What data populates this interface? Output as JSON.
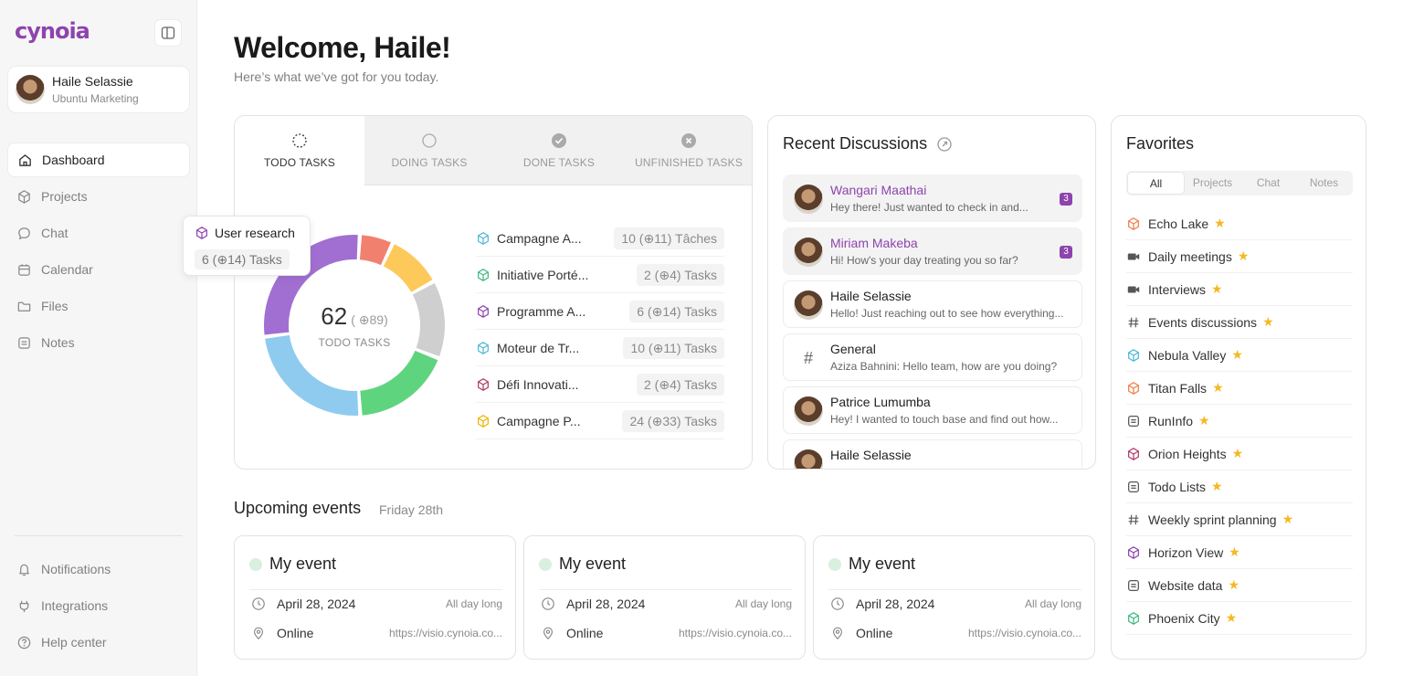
{
  "brand": {
    "logo": "cynoia"
  },
  "user": {
    "name": "Haile Selassie",
    "org": "Ubuntu Marketing"
  },
  "nav": {
    "main": [
      {
        "label": "Dashboard",
        "icon": "home-icon",
        "active": true
      },
      {
        "label": "Projects",
        "icon": "cube-icon"
      },
      {
        "label": "Chat",
        "icon": "chat-icon"
      },
      {
        "label": "Calendar",
        "icon": "calendar-icon"
      },
      {
        "label": "Files",
        "icon": "folder-icon"
      },
      {
        "label": "Notes",
        "icon": "note-icon"
      }
    ],
    "bottom": [
      {
        "label": "Notifications",
        "icon": "bell-icon"
      },
      {
        "label": "Integrations",
        "icon": "plug-icon"
      },
      {
        "label": "Help center",
        "icon": "help-icon"
      }
    ]
  },
  "header": {
    "title": "Welcome, Haile!",
    "subtitle": "Here’s what we’ve got for you today."
  },
  "tasks": {
    "tabs": [
      {
        "label": "TODO TASKS",
        "icon": "dashed-circle-icon",
        "active": true
      },
      {
        "label": "DOING TASKS",
        "icon": "half-circle-icon"
      },
      {
        "label": "DONE TASKS",
        "icon": "check-circle-icon"
      },
      {
        "label": "UNFINISHED TASKS",
        "icon": "x-circle-icon"
      }
    ],
    "total": "62",
    "total_all": "89",
    "center_label": "TODO TASKS",
    "tooltip": {
      "name": "User research",
      "count": "6",
      "total": "14",
      "unit": "Tasks"
    },
    "projects": [
      {
        "name": "Campagne A...",
        "count": "10",
        "total": "11",
        "unit": "Tâches",
        "color": "#4fb8d6"
      },
      {
        "name": "Initiative Porté...",
        "count": "2",
        "total": "4",
        "unit": "Tasks",
        "color": "#3fb87f"
      },
      {
        "name": "Programme A...",
        "count": "6",
        "total": "14",
        "unit": "Tasks",
        "color": "#8e44ad"
      },
      {
        "name": "Moteur de Tr...",
        "count": "10",
        "total": "11",
        "unit": "Tasks",
        "color": "#4fb8d6"
      },
      {
        "name": "Défi Innovati...",
        "count": "2",
        "total": "4",
        "unit": "Tasks",
        "color": "#b03a6a"
      },
      {
        "name": "Campagne P...",
        "count": "24",
        "total": "33",
        "unit": "Tasks",
        "color": "#f0b400"
      }
    ],
    "chart_segments": [
      {
        "color": "#f2806e",
        "value": 6
      },
      {
        "color": "#fdc95a",
        "value": 10
      },
      {
        "color": "#cfcfcf",
        "value": 14
      },
      {
        "color": "#5fd47e",
        "value": 18
      },
      {
        "color": "#8fcbef",
        "value": 24
      },
      {
        "color": "#a16fd1",
        "value": 28
      }
    ]
  },
  "discussions": {
    "title": "Recent Discussions",
    "items": [
      {
        "name": "Wangari Maathai",
        "message": "Hey there! Just wanted to check in and...",
        "unread": "3",
        "type": "user"
      },
      {
        "name": "Miriam Makeba",
        "message": "Hi! How's your day treating you so far?",
        "unread": "3",
        "type": "user"
      },
      {
        "name": "Haile Selassie",
        "message": "Hello! Just reaching out to see how everything...",
        "unread": "",
        "type": "user"
      },
      {
        "name": "General",
        "message": "Aziza Bahnini: Hello team, how are you doing?",
        "unread": "",
        "type": "channel"
      },
      {
        "name": "Patrice Lumumba",
        "message": "Hey! I wanted to touch base and find out how...",
        "unread": "",
        "type": "user"
      },
      {
        "name": "Haile Selassie",
        "message": "",
        "unread": "",
        "type": "user"
      }
    ]
  },
  "favorites": {
    "title": "Favorites",
    "tabs": [
      "All",
      "Projects",
      "Chat",
      "Notes"
    ],
    "items": [
      {
        "label": "Echo Lake",
        "icon": "cube-icon",
        "color": "#f07e4a"
      },
      {
        "label": "Daily meetings",
        "icon": "video-icon",
        "color": "#555555"
      },
      {
        "label": "Interviews",
        "icon": "video-icon",
        "color": "#555555"
      },
      {
        "label": "Events discussions",
        "icon": "hash-icon",
        "color": "#555555"
      },
      {
        "label": "Nebula Valley",
        "icon": "cube-icon",
        "color": "#4fb8d6"
      },
      {
        "label": "Titan Falls",
        "icon": "cube-icon",
        "color": "#f07e4a"
      },
      {
        "label": "RunInfo",
        "icon": "note-icon",
        "color": "#555555"
      },
      {
        "label": "Orion Heights",
        "icon": "cube-icon",
        "color": "#b03a6a"
      },
      {
        "label": "Todo Lists",
        "icon": "note-icon",
        "color": "#555555"
      },
      {
        "label": "Weekly sprint planning",
        "icon": "hash-icon",
        "color": "#555555"
      },
      {
        "label": "Horizon View",
        "icon": "cube-icon",
        "color": "#8e44ad"
      },
      {
        "label": "Website data",
        "icon": "note-icon",
        "color": "#555555"
      },
      {
        "label": "Phoenix City",
        "icon": "cube-icon",
        "color": "#3fb87f"
      }
    ]
  },
  "events": {
    "title": "Upcoming events",
    "date": "Friday 28th",
    "items": [
      {
        "title": "My event",
        "date": "April 28, 2024",
        "duration": "All day long",
        "location": "Online",
        "link": "https://visio.cynoia.co..."
      },
      {
        "title": "My event",
        "date": "April 28, 2024",
        "duration": "All day long",
        "location": "Online",
        "link": "https://visio.cynoia.co..."
      },
      {
        "title": "My event",
        "date": "April 28, 2024",
        "duration": "All day long",
        "location": "Online",
        "link": "https://visio.cynoia.co..."
      }
    ]
  }
}
